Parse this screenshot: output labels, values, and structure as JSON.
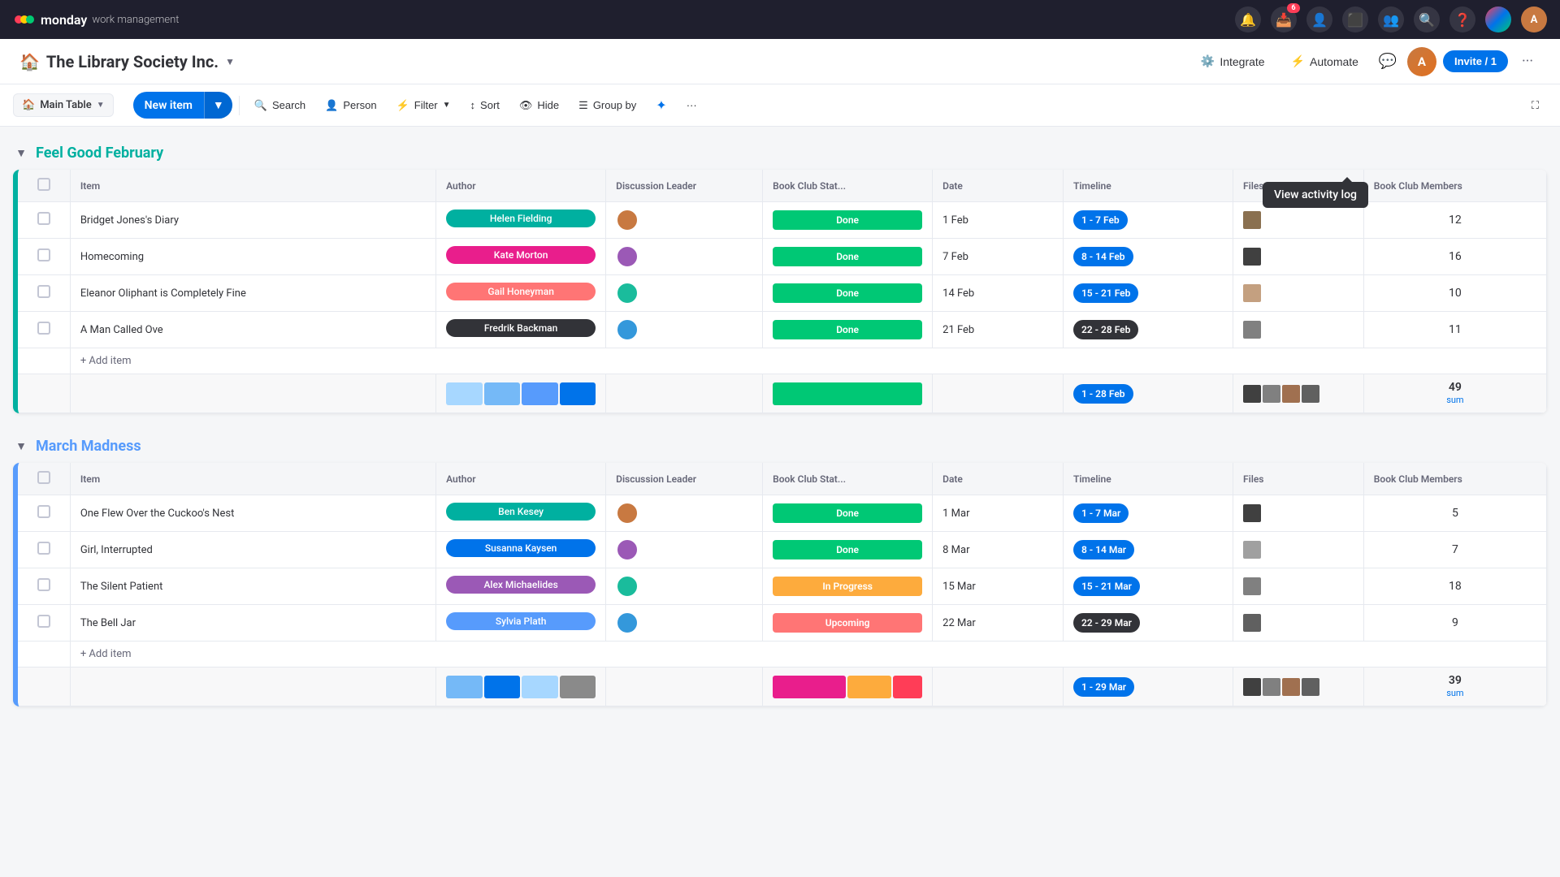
{
  "app": {
    "name": "monday",
    "subtitle": "work management"
  },
  "workspace": {
    "title": "The Library Society Inc.",
    "invite_label": "Invite / 1",
    "integrate_label": "Integrate",
    "automate_label": "Automate"
  },
  "toolbar": {
    "table_view_label": "Main Table",
    "new_item_label": "New item",
    "search_label": "Search",
    "person_label": "Person",
    "filter_label": "Filter",
    "sort_label": "Sort",
    "hide_label": "Hide",
    "group_by_label": "Group by"
  },
  "activity_log": {
    "tooltip": "View activity log"
  },
  "nav": {
    "notification_badge": "6"
  },
  "groups": [
    {
      "id": "feel-good-feb",
      "title": "Feel Good February",
      "color": "teal",
      "columns": [
        "Item",
        "Author",
        "Discussion Leader",
        "Book Club Stat...",
        "Date",
        "Timeline",
        "Files",
        "Book Club Members"
      ],
      "rows": [
        {
          "item": "Bridget Jones's Diary",
          "author": "Helen Fielding",
          "author_color": "a-teal",
          "status": "Done",
          "status_class": "status-done",
          "date": "1 Feb",
          "timeline": "1 - 7 Feb",
          "timeline_dark": false,
          "members": "12",
          "files_count": 1
        },
        {
          "item": "Homecoming",
          "author": "Kate Morton",
          "author_color": "a-pink",
          "status": "Done",
          "status_class": "status-done",
          "date": "7 Feb",
          "timeline": "8 - 14 Feb",
          "timeline_dark": false,
          "members": "16",
          "files_count": 1
        },
        {
          "item": "Eleanor Oliphant is Completely Fine",
          "author": "Gail Honeyman",
          "author_color": "a-orange",
          "status": "Done",
          "status_class": "status-done",
          "date": "14 Feb",
          "timeline": "15 - 21 Feb",
          "timeline_dark": false,
          "members": "10",
          "files_count": 1
        },
        {
          "item": "A Man Called Ove",
          "author": "Fredrik Backman",
          "author_color": "a-dark",
          "status": "Done",
          "status_class": "status-done",
          "date": "21 Feb",
          "timeline": "22 - 28 Feb",
          "timeline_dark": true,
          "members": "11",
          "files_count": 1
        }
      ],
      "summary": {
        "timeline_label": "1 - 28 Feb",
        "sum_value": "49",
        "sum_label": "sum"
      }
    },
    {
      "id": "march-madness",
      "title": "March Madness",
      "color": "blue",
      "columns": [
        "Item",
        "Author",
        "Discussion Leader",
        "Book Club Stat...",
        "Date",
        "Timeline",
        "Files",
        "Book Club Members"
      ],
      "rows": [
        {
          "item": "One Flew Over the Cuckoo's Nest",
          "author": "Ben Kesey",
          "author_color": "a-teal",
          "status": "Done",
          "status_class": "status-done",
          "date": "1 Mar",
          "timeline": "1 - 7 Mar",
          "timeline_dark": false,
          "members": "5",
          "files_count": 1
        },
        {
          "item": "Girl, Interrupted",
          "author": "Susanna Kaysen",
          "author_color": "a-blue",
          "status": "Done",
          "status_class": "status-done",
          "date": "8 Mar",
          "timeline": "8 - 14 Mar",
          "timeline_dark": false,
          "members": "7",
          "files_count": 1
        },
        {
          "item": "The Silent Patient",
          "author": "Alex Michaelides",
          "author_color": "a-purple",
          "status": "In Progress",
          "status_class": "status-inprogress",
          "date": "15 Mar",
          "timeline": "15 - 21 Mar",
          "timeline_dark": false,
          "members": "18",
          "files_count": 1
        },
        {
          "item": "The Bell Jar",
          "author": "Sylvia Plath",
          "author_color": "a-light",
          "status": "Upcoming",
          "status_class": "status-upcoming",
          "date": "22 Mar",
          "timeline": "22 - 29 Mar",
          "timeline_dark": true,
          "members": "9",
          "files_count": 1
        }
      ],
      "summary": {
        "timeline_label": "1 - 29 Mar",
        "sum_value": "39",
        "sum_label": "sum"
      }
    }
  ]
}
